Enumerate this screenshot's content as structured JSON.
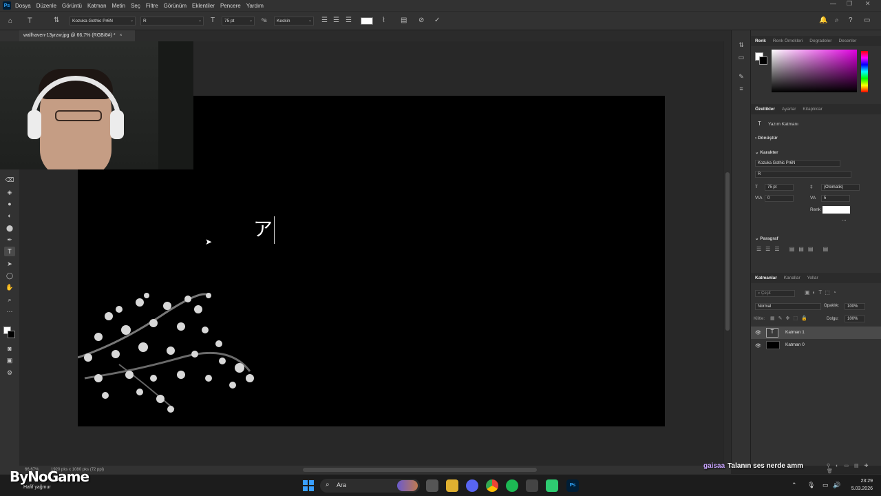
{
  "menubar": {
    "logo": "Ps",
    "items": [
      "Dosya",
      "Düzenle",
      "Görüntü",
      "Katman",
      "Metin",
      "Seç",
      "Filtre",
      "Görünüm",
      "Eklentiler",
      "Pencere",
      "Yardım"
    ]
  },
  "options": {
    "font_family": "Kozuka Gothic Pr6N",
    "font_style": "R",
    "font_size": "75 pt",
    "antialias": "Keskin",
    "text_color": "#ffffff"
  },
  "document": {
    "tab_title": "wallhaven-13yrzw.jpg @ 66,7% (RGB/8#) *",
    "canvas_text": "ア",
    "background": "#000000"
  },
  "status": {
    "zoom": "66,67%",
    "dimensions": "1920 pks x 1080 pks (72 ppi)"
  },
  "panels": {
    "color_tabs": [
      "Renk",
      "Renk Örnekleri",
      "Degradeler",
      "Desenler"
    ],
    "props_tabs": [
      "Özellikler",
      "Ayarlar",
      "Kitaplıklar"
    ],
    "layer_kind": "Yazım Katmanı",
    "transform": "Dönüştür",
    "character": {
      "title": "Karakter",
      "font": "Kozuka Gothic Pr6N",
      "style": "R",
      "size": "75 pt",
      "leading": "(Otomatik)",
      "kerning": "0",
      "tracking": "5",
      "color_label": "Renk"
    },
    "paragraph": {
      "title": "Paragraf"
    },
    "layers_tabs": [
      "Katmanlar",
      "Kanallar",
      "Yollar"
    ],
    "layers": {
      "search_placeholder": "Çeşit",
      "blend_mode": "Normal",
      "opacity_label": "Opaklık:",
      "opacity": "100%",
      "lock_label": "Kilitle:",
      "fill_label": "Dolgu:",
      "fill": "100%",
      "items": [
        {
          "name": "Katman 1",
          "thumb": "T"
        },
        {
          "name": "Katman 0",
          "thumb": ""
        }
      ]
    }
  },
  "taskbar": {
    "search": "Ara",
    "time": "23:29",
    "date": "5.03.2026"
  },
  "overlay": {
    "brand": "ByNoGame",
    "subtitle": "Hafif yağmur",
    "chat_user": "gaisaa",
    "chat_message": "Talanın ses nerde amm"
  }
}
